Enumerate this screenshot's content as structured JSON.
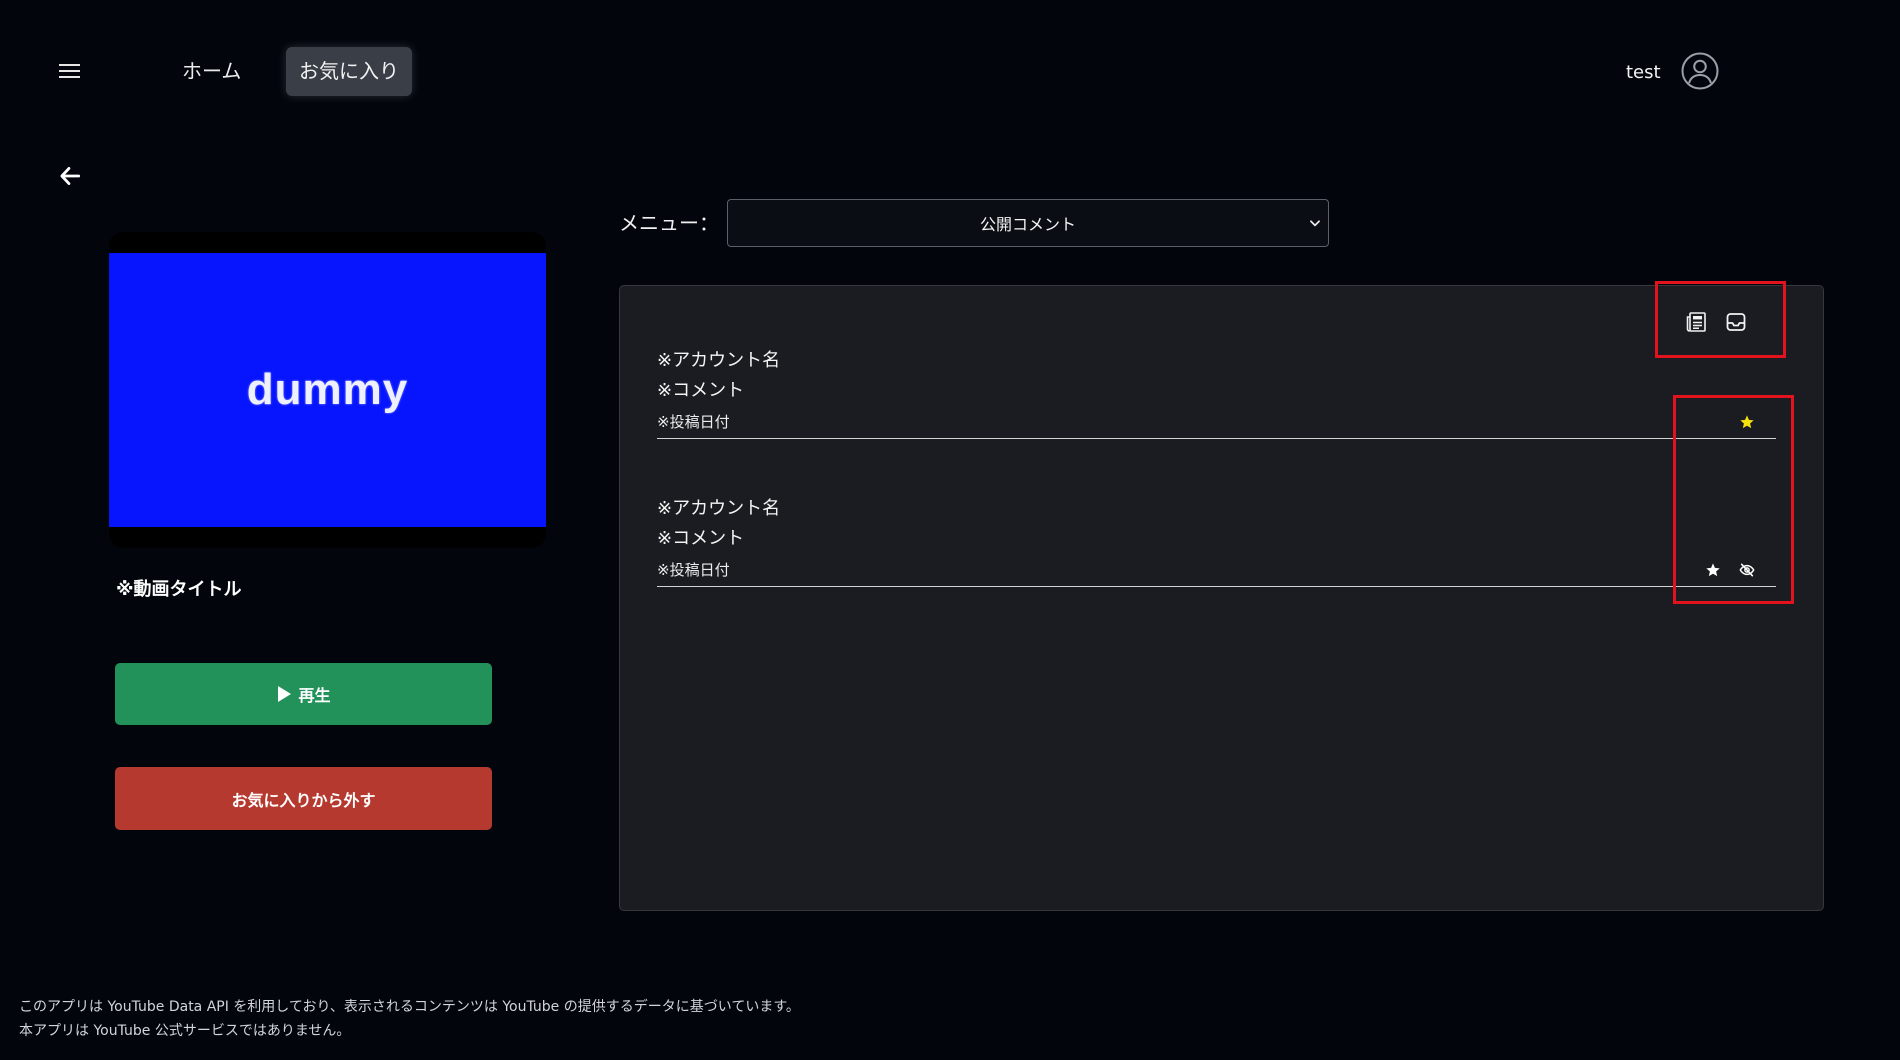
{
  "colors": {
    "background": "#02050c",
    "panel": "#1b1c21",
    "thumbnail": "#0715ff",
    "play_button": "#23915a",
    "remove_button": "#b5392e",
    "annotation": "#e3131d",
    "star_active": "#f5e20b",
    "star_inactive": "#ffffff"
  },
  "header": {
    "menu_icon": "hamburger-icon",
    "nav": [
      {
        "label": "ホーム",
        "active": false
      },
      {
        "label": "お気に入り",
        "active": true
      }
    ],
    "username": "test",
    "avatar_icon": "user-circle-icon"
  },
  "back_button": {
    "icon": "arrow-left-icon"
  },
  "video": {
    "thumbnail_text": "dummy",
    "title": "※動画タイトル",
    "play_icon": "play-icon",
    "play_label": "再生",
    "remove_favorite_label": "お気に入りから外す"
  },
  "menu": {
    "label": "メニュー：",
    "selected": "公開コメント",
    "chevron_icon": "chevron-down-icon"
  },
  "comments_panel": {
    "toolbar_icons": [
      "newspaper-icon",
      "inbox-icon"
    ],
    "comments": [
      {
        "account": "※アカウント名",
        "comment": "※コメント",
        "date": "※投稿日付",
        "favorited": true,
        "icons": [
          "star-icon"
        ]
      },
      {
        "account": "※アカウント名",
        "comment": "※コメント",
        "date": "※投稿日付",
        "favorited": false,
        "icons": [
          "star-icon",
          "eye-slash-icon"
        ]
      }
    ]
  },
  "footer": {
    "line1": "このアプリは YouTube Data API を利用しており、表示されるコンテンツは YouTube の提供するデータに基づいています。",
    "line2": "本アプリは YouTube 公式サービスではありません。"
  }
}
